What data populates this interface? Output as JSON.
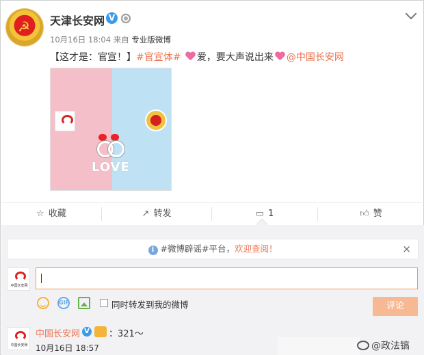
{
  "post": {
    "author": "天津长安网",
    "verified_mark": "V",
    "time": "10月16日 18:04",
    "source_prefix": "来自",
    "source": "专业版微博",
    "text_start": "【这才是：官宣！】",
    "topic": "#官宣体#",
    "text_mid": "爱，要大声说出来",
    "mention": "@中国长安网",
    "image": {
      "caption_word": "LOVE",
      "left_color": "#f4bfc9",
      "right_color": "#bfe1f4",
      "icons": [
        "changan-logo",
        "party-emblem-badge",
        "wedding-rings-icon",
        "heart-icon"
      ]
    }
  },
  "actions": {
    "favorite": "收藏",
    "repost": "转发",
    "comment_count": "1",
    "like": "赞"
  },
  "notice": {
    "text_before": "#微博辟谣#平台，",
    "text_highlight": "欢迎查阅！",
    "close": "×",
    "info": "i"
  },
  "composer": {
    "checkbox_label": "同时转发到我的微博",
    "submit": "评论",
    "gif": "GIF",
    "logo_caption": "中国长安网"
  },
  "comment": {
    "name": "中国长安网",
    "verified_mark": "V",
    "text": "：321～",
    "time": "10月16日 18:57"
  },
  "watermark": "@政法镐",
  "colors": {
    "accent": "#eb7350",
    "verified": "#3d9ae8",
    "submit_disabled": "#f7b894"
  }
}
